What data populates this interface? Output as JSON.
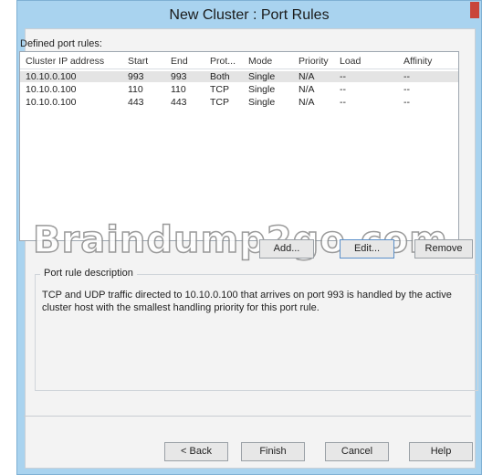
{
  "window": {
    "title": "New Cluster : Port Rules"
  },
  "rules": {
    "label": "Defined port rules:",
    "columns": [
      "Cluster IP address",
      "Start",
      "End",
      "Prot...",
      "Mode",
      "Priority",
      "Load",
      "Affinity"
    ],
    "rows": [
      [
        "10.10.0.100",
        "993",
        "993",
        "Both",
        "Single",
        "N/A",
        "--",
        "--"
      ],
      [
        "10.10.0.100",
        "110",
        "110",
        "TCP",
        "Single",
        "N/A",
        "--",
        "--"
      ],
      [
        "10.10.0.100",
        "443",
        "443",
        "TCP",
        "Single",
        "N/A",
        "--",
        "--"
      ]
    ]
  },
  "watermark": "Braindump2go.com",
  "buttons": {
    "add": "Add...",
    "edit": "Edit...",
    "remove": "Remove"
  },
  "description": {
    "title": "Port rule description",
    "text": "TCP and UDP traffic directed to 10.10.0.100 that arrives on port 993 is handled by the active cluster host with the smallest handling priority for this port rule."
  },
  "footer": {
    "back": "< Back",
    "finish": "Finish",
    "cancel": "Cancel",
    "help": "Help"
  },
  "colors": {
    "frame": "#a9d3ef",
    "close": "#c9453a"
  }
}
